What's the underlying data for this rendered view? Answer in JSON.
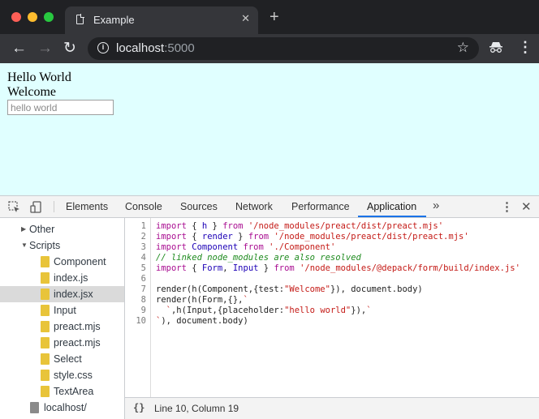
{
  "browser": {
    "tab_title": "Example",
    "tab_close": "✕",
    "new_tab": "+",
    "url_host": "localhost",
    "url_port": ":5000",
    "back": "←",
    "forward": "→",
    "reload": "↻",
    "star": "☆",
    "menu": "⋮"
  },
  "page": {
    "line1": "Hello World",
    "line2": "Welcome",
    "input_placeholder": "hello world",
    "background": "#e0ffff"
  },
  "devtools": {
    "tabs": [
      "Elements",
      "Console",
      "Sources",
      "Network",
      "Performance",
      "Application"
    ],
    "active_tab": "Application",
    "more": "»",
    "kebab": "⋮",
    "close": "✕",
    "tree": [
      {
        "label": "Other",
        "type": "folder",
        "expanded": false
      },
      {
        "label": "Scripts",
        "type": "folder",
        "expanded": true
      },
      {
        "label": "Component",
        "type": "file"
      },
      {
        "label": "index.js",
        "type": "file"
      },
      {
        "label": "index.jsx",
        "type": "file",
        "selected": true
      },
      {
        "label": "Input",
        "type": "file"
      },
      {
        "label": "preact.mjs",
        "type": "file"
      },
      {
        "label": "preact.mjs",
        "type": "file"
      },
      {
        "label": "Select",
        "type": "file"
      },
      {
        "label": "style.css",
        "type": "file"
      },
      {
        "label": "TextArea",
        "type": "file"
      },
      {
        "label": "localhost/",
        "type": "host"
      }
    ],
    "code": {
      "line_numbers": [
        "1",
        "2",
        "3",
        "4",
        "5",
        "6",
        "7",
        "8",
        "9",
        "10"
      ],
      "lines": [
        "import { h } from '/node_modules/preact/dist/preact.mjs'",
        "import { render } from '/node_modules/preact/dist/preact.mjs'",
        "import Component from './Component'",
        "// linked node_modules are also resolved",
        "import { Form, Input } from '/node_modules/@depack/form/build/index.js'",
        "",
        "render(h(Component,{test:\"Welcome\"}), document.body)",
        "render(h(Form,{},`",
        "  `,h(Input,{placeholder:\"hello world\"}),`",
        "`), document.body)"
      ]
    },
    "status": {
      "braces": "{}",
      "position": "Line 10, Column 19"
    }
  }
}
